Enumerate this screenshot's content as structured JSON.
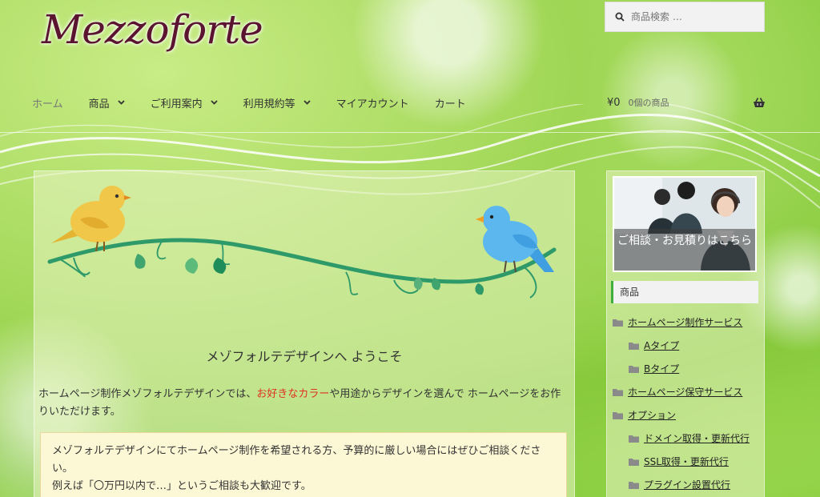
{
  "site": {
    "logo": "Mezzoforte"
  },
  "search": {
    "placeholder": "商品検索 …"
  },
  "nav": {
    "items": [
      {
        "label": "ホーム",
        "dropdown": false,
        "active": true
      },
      {
        "label": "商品",
        "dropdown": true
      },
      {
        "label": "ご利用案内",
        "dropdown": true
      },
      {
        "label": "利用規約等",
        "dropdown": true
      },
      {
        "label": "マイアカウント",
        "dropdown": false
      },
      {
        "label": "カート",
        "dropdown": false
      }
    ]
  },
  "cart": {
    "total": "¥0",
    "count": "0個の商品",
    "icon": "basket-icon"
  },
  "main": {
    "welcome": "メゾフォルテデザインへ ようこそ",
    "intro_pre": "ホームページ制作メゾフォルテデザインでは、",
    "intro_accent": "お好きなカラー",
    "intro_post": "や用途からデザインを選んで ホームページをお作りいただけます。",
    "notice_line1": "メゾフォルテデザインにてホームページ制作を希望される方、予算的に厳しい場合にはぜひご相談ください。",
    "notice_line2": "例えば「〇万円以内で…」というご相談も大歓迎です。"
  },
  "sidebar": {
    "consult_label": "ご相談・お見積りはこちら",
    "widget_title": "商品",
    "items": [
      {
        "label": "ホームページ制作サービス",
        "level": 0
      },
      {
        "label": "Aタイプ",
        "level": 1
      },
      {
        "label": "Bタイプ",
        "level": 1
      },
      {
        "label": "ホームページ保守サービス",
        "level": 0
      },
      {
        "label": "オプション",
        "level": 0
      },
      {
        "label": "ドメイン取得・更新代行",
        "level": 1
      },
      {
        "label": "SSL取得・更新代行",
        "level": 1
      },
      {
        "label": "プラグイン設置代行",
        "level": 1
      }
    ]
  },
  "colors": {
    "logo": "#5a1430",
    "accent_red": "#e0301e",
    "widget_accent": "#3fae3c",
    "notice_bg": "#fcf7d4"
  }
}
